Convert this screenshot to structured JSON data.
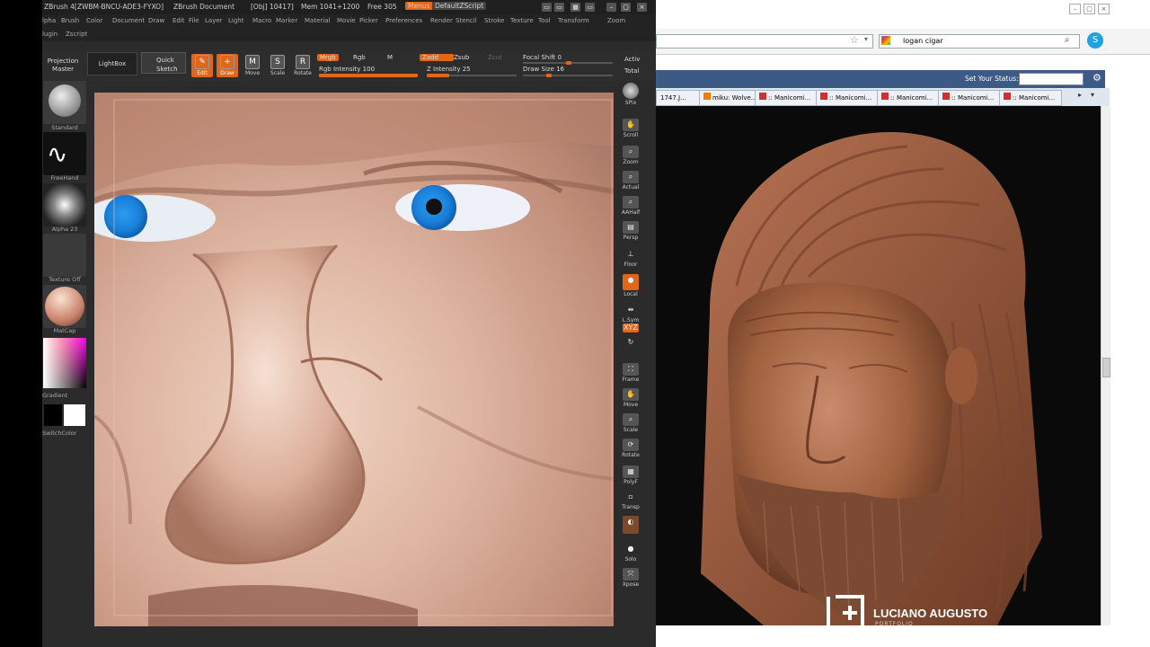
{
  "zbrush": {
    "title": "ZBrush 4[ZWBM-BNCU-ADE3-FYXO]",
    "document": "ZBrush Document",
    "obj": "[Obj] 10417]",
    "mem": "Mem 1041+1200",
    "free": "Free 305",
    "menus_btn": "Menus",
    "script_btn": "DefaultZScript",
    "menus": [
      "lpha",
      "Brush",
      "Color",
      "Document",
      "Draw",
      "Edit",
      "File",
      "Layer",
      "Light",
      "Macro",
      "Marker",
      "Material",
      "Movie",
      "Picker",
      "Preferences",
      "Render",
      "Stencil",
      "Stroke",
      "Texture",
      "Tool",
      "Transform",
      "Zoom"
    ],
    "menus2": [
      "lugin",
      "Zscript"
    ],
    "toolbar": {
      "projection_master": "Projection Master",
      "lightbox": "LightBox",
      "quick_sketch": "Quick Sketch",
      "edit": "Edit",
      "draw": "Draw",
      "move": "Move",
      "scale": "Scale",
      "rotate": "Rotate",
      "mrgb": "Mrgb",
      "rgb": "Rgb",
      "m": "M",
      "zadd": "Zadd",
      "zsub": "Zsub",
      "zcut": "Zcut",
      "rgb_intensity": "Rgb Intensity 100",
      "z_intensity": "Z Intensity 25",
      "focal_shift": "Focal Shift 0",
      "draw_size": "Draw Size 16",
      "active": "Activ",
      "total": "Total",
      "rgb_intensity_value": 1.0,
      "z_intensity_value": 0.25,
      "focal_shift_value": 0.5,
      "draw_size_value": 0.3
    },
    "left": {
      "standard": "Standard",
      "freehand": "FreeHand",
      "alpha": "Alpha 23",
      "texture": "Texture Off",
      "material": "MatCap",
      "gradient": "Gradient",
      "switchcolor": "SwitchColor"
    },
    "right": {
      "spix": "SPix",
      "scroll": "Scroll",
      "zoom": "Zoom",
      "actual": "Actual",
      "aahalf": "AAHalf",
      "persp": "Persp",
      "floor": "Floor",
      "local": "Local",
      "lsym": "L.Sym",
      "xyz": "XYZ",
      "frame": "Frame",
      "move": "Move",
      "scale": "Scale",
      "rotate": "Rotate",
      "polyf": "PolyF",
      "transp": "Transp",
      "solo": "Solo",
      "xpose": "Xpose"
    }
  },
  "browser": {
    "search_text": "logan cigar",
    "status_label": "Set Your Status:",
    "tabs": [
      "1747.J...",
      "miku: Wolve...",
      ":: Manicomi...",
      ":: Manicomi...",
      ":: Manicomi...",
      ":: Manicomi...",
      ":: Manicomi..."
    ],
    "watermark_name": "LUCIANO AUGUSTO",
    "watermark_sub": "PORTFOLIO"
  },
  "colors": {
    "accent": "#e0661a",
    "panel": "#2b2b2b",
    "status_bar": "#3c5a86"
  }
}
